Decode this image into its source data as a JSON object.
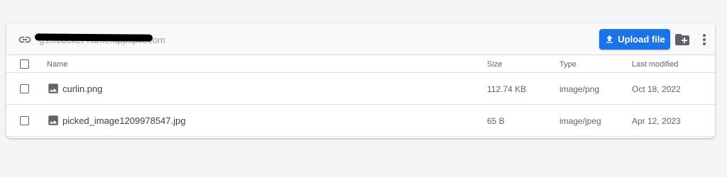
{
  "toolbar": {
    "bucket_path": "gs://bucket-name.appspot.com",
    "upload_label": "Upload file",
    "link_icon": "link-icon",
    "folder_icon": "create-folder-icon",
    "more_icon": "more-vert-icon"
  },
  "table": {
    "columns": [
      "Name",
      "Size",
      "Type",
      "Last modified"
    ],
    "rows": [
      {
        "name": "curlin.png",
        "size": "112.74 KB",
        "type": "image/png",
        "modified": "Oct 18, 2022",
        "icon": "image-file-icon"
      },
      {
        "name": "picked_image1209978547.jpg",
        "size": "65 B",
        "type": "image/jpeg",
        "modified": "Apr 12, 2023",
        "icon": "image-file-icon"
      }
    ]
  },
  "colors": {
    "accent": "#1a73e8",
    "icon": "#5f6368"
  }
}
